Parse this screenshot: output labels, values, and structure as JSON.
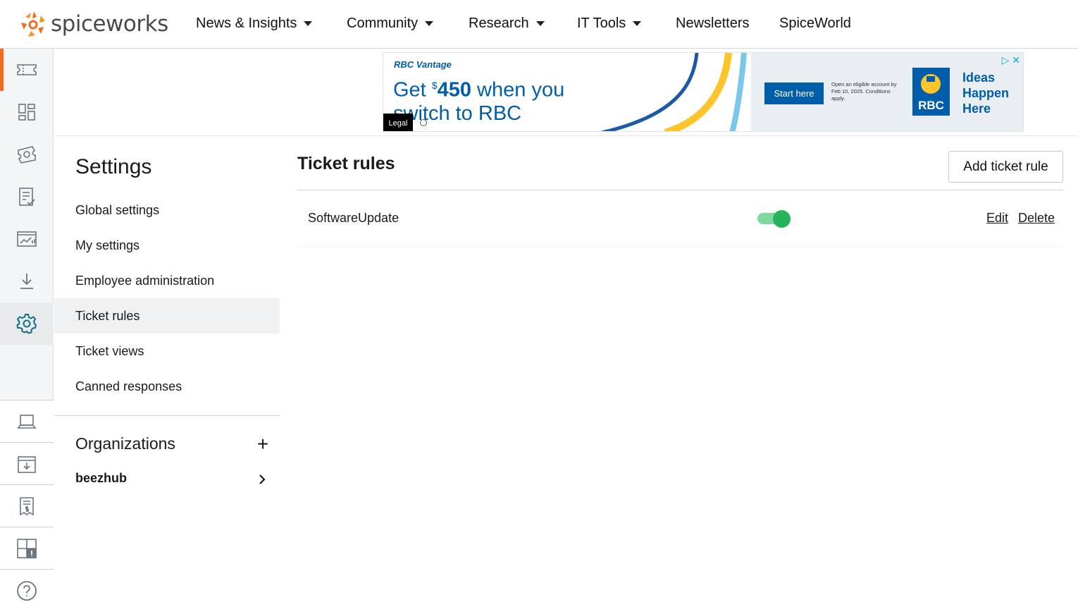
{
  "brand": {
    "logo_text": "spiceworks",
    "accent": "#f26b21"
  },
  "topnav": {
    "items": [
      {
        "label": "News & Insights",
        "dropdown": true
      },
      {
        "label": "Community",
        "dropdown": true
      },
      {
        "label": "Research",
        "dropdown": true
      },
      {
        "label": "IT Tools",
        "dropdown": true
      },
      {
        "label": "Newsletters",
        "dropdown": false
      },
      {
        "label": "SpiceWorld",
        "dropdown": false
      }
    ]
  },
  "rail": {
    "upper": [
      "tickets-icon",
      "dashboard-icon",
      "ticket-rules-icon",
      "checklist-icon",
      "reports-icon",
      "download-icon",
      "settings-icon"
    ],
    "lower": [
      "laptop-icon",
      "inventory-icon",
      "invoice-icon",
      "alerts-grid-icon",
      "help-icon"
    ]
  },
  "ad": {
    "brand": "RBC Vantage",
    "headline_pre": "Get ",
    "headline_sup": "$",
    "headline_amount": "450",
    "headline_post": " when you switch to RBC",
    "legal": "Legal",
    "cta": "Start here",
    "small_print": "Open an eligible account by Feb 10, 2025. Conditions apply.",
    "logo": "RBC",
    "tagline": "Ideas Happen Here"
  },
  "settings": {
    "title": "Settings",
    "menu": [
      {
        "label": "Global settings",
        "active": false
      },
      {
        "label": "My settings",
        "active": false
      },
      {
        "label": "Employee administration",
        "active": false
      },
      {
        "label": "Ticket rules",
        "active": true
      },
      {
        "label": "Ticket views",
        "active": false
      },
      {
        "label": "Canned responses",
        "active": false
      }
    ],
    "organizations_title": "Organizations",
    "organizations": [
      {
        "label": "beezhub"
      }
    ]
  },
  "main": {
    "title": "Ticket rules",
    "add_button": "Add ticket rule",
    "rules": [
      {
        "name": "SoftwareUpdate",
        "enabled": true,
        "edit_label": "Edit",
        "delete_label": "Delete"
      }
    ]
  }
}
